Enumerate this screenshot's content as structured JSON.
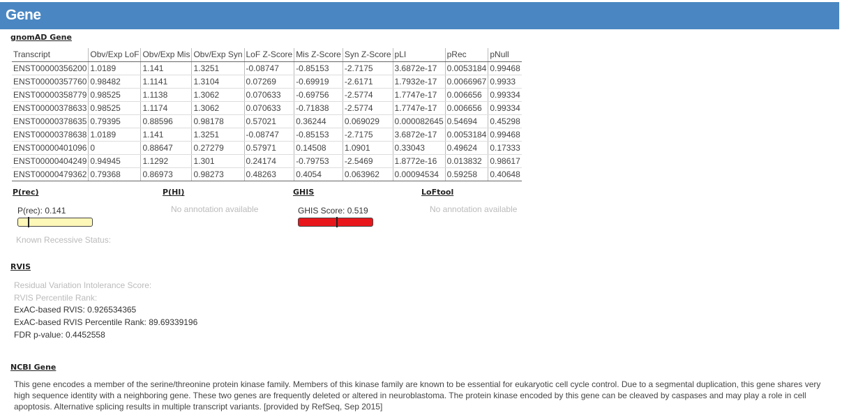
{
  "header": {
    "title": "Gene"
  },
  "gnomad": {
    "title": "gnomAD Gene",
    "columns": [
      "Transcript",
      "Obv/Exp LoF",
      "Obv/Exp Mis",
      "Obv/Exp Syn",
      "LoF Z-Score",
      "Mis Z-Score",
      "Syn Z-Score",
      "pLI",
      "pRec",
      "pNull"
    ],
    "rows": [
      [
        "ENST00000356200",
        "1.0189",
        "1.141",
        "1.3251",
        "-0.08747",
        "-0.85153",
        "-2.7175",
        "3.6872e-17",
        "0.0053184",
        "0.99468"
      ],
      [
        "ENST00000357760",
        "0.98482",
        "1.1141",
        "1.3104",
        "0.07269",
        "-0.69919",
        "-2.6171",
        "1.7932e-17",
        "0.0066967",
        "0.9933"
      ],
      [
        "ENST00000358779",
        "0.98525",
        "1.1138",
        "1.3062",
        "0.070633",
        "-0.69756",
        "-2.5774",
        "1.7747e-17",
        "0.006656",
        "0.99334"
      ],
      [
        "ENST00000378633",
        "0.98525",
        "1.1174",
        "1.3062",
        "0.070633",
        "-0.71838",
        "-2.5774",
        "1.7747e-17",
        "0.006656",
        "0.99334"
      ],
      [
        "ENST00000378635",
        "0.79395",
        "0.88596",
        "0.98178",
        "0.57021",
        "0.36244",
        "0.069029",
        "0.000082645",
        "0.54694",
        "0.45298"
      ],
      [
        "ENST00000378638",
        "1.0189",
        "1.141",
        "1.3251",
        "-0.08747",
        "-0.85153",
        "-2.7175",
        "3.6872e-17",
        "0.0053184",
        "0.99468"
      ],
      [
        "ENST00000401096",
        "0",
        "0.88647",
        "0.27279",
        "0.57971",
        "0.14508",
        "1.0901",
        "0.33043",
        "0.49624",
        "0.17333"
      ],
      [
        "ENST00000404249",
        "0.94945",
        "1.1292",
        "1.301",
        "0.24174",
        "-0.79753",
        "-2.5469",
        "1.8772e-16",
        "0.013832",
        "0.98617"
      ],
      [
        "ENST00000479362",
        "0.79368",
        "0.86973",
        "0.98273",
        "0.48263",
        "0.4054",
        "0.063962",
        "0.00094534",
        "0.59258",
        "0.40648"
      ]
    ]
  },
  "prec": {
    "title": "P(rec)",
    "label": "P(rec): 0.141",
    "value": 0.141,
    "bar_color": "#fdf7b8",
    "known_status": "Known Recessive Status:"
  },
  "phi": {
    "title": "P(HI)",
    "empty": "No annotation available"
  },
  "ghis": {
    "title": "GHIS",
    "label": "GHIS Score: 0.519",
    "value": 0.519,
    "bar_color": "#e8161b"
  },
  "loftool": {
    "title": "LoFtool",
    "empty": "No annotation available"
  },
  "rvis": {
    "title": "RVIS",
    "residual_label": "Residual Variation Intolerance Score:",
    "percentile_label": "RVIS Percentile Rank:",
    "exac_rvis": "ExAC-based RVIS: 0.926534365",
    "exac_percentile": "ExAC-based RVIS Percentile Rank: 89.69339196",
    "fdr": "FDR p-value: 0.4452558"
  },
  "ncbi": {
    "title": "NCBI Gene",
    "text": "This gene encodes a member of the serine/threonine protein kinase family. Members of this kinase family are known to be essential for eukaryotic cell cycle control. Due to a segmental duplication, this gene shares very high sequence identity with a neighboring gene. These two genes are frequently deleted or altered in neuroblastoma. The protein kinase encoded by this gene can be cleaved by caspases and may play a role in cell apoptosis. Alternative splicing results in multiple transcript variants. [provided by RefSeq, Sep 2015]"
  }
}
